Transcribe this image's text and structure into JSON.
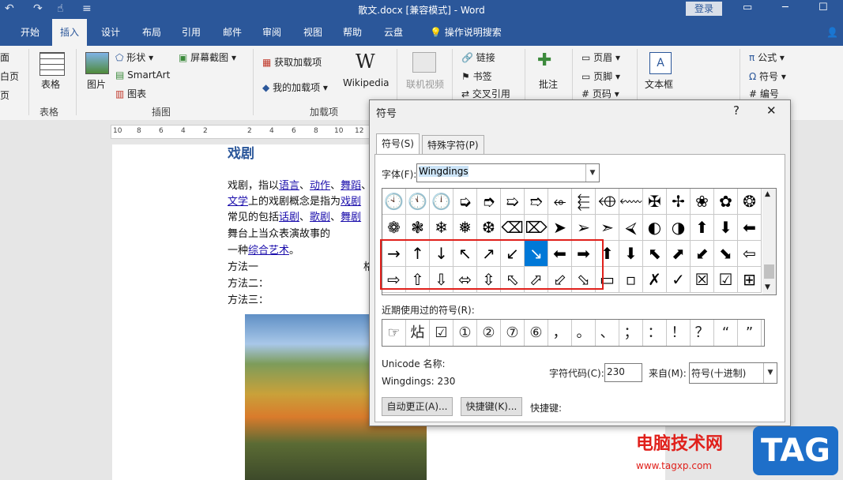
{
  "titlebar": {
    "title": "散文.docx [兼容模式] - Word",
    "login_label": "登录",
    "undo_icon": "↶",
    "redo_icon": "↷",
    "touch_icon": "☝",
    "customize_icon": "≡",
    "restore_icon": "▭",
    "minimize_icon": "─",
    "maximize_icon": "☐"
  },
  "tabs": [
    "开始",
    "插入",
    "设计",
    "布局",
    "引用",
    "邮件",
    "审阅",
    "视图",
    "帮助",
    "云盘",
    "操作说明搜索"
  ],
  "active_tab": "插入",
  "share_label": "共",
  "ribbon": {
    "left_cut": [
      "面",
      "白页",
      "页"
    ],
    "table_label": "表格",
    "table_group": "表格",
    "picture_label": "图片",
    "shapes_label": "形状",
    "smartart_label": "SmartArt",
    "chart_label": "图表",
    "screenshot_label": "屏幕截图",
    "illus_group": "插图",
    "get_addins_label": "获取加载项",
    "my_addins_label": "我的加载项",
    "wikipedia_label": "Wikipedia",
    "addins_group": "加载项",
    "online_video_label": "联机视频",
    "link_label": "链接",
    "bookmark_label": "书签",
    "crossref_label": "交叉引用",
    "comment_label": "批注",
    "header_label": "页眉",
    "footer_label": "页脚",
    "pagenum_label": "页码",
    "textbox_label": "文本框",
    "equation_label": "公式",
    "symbol_label": "符号",
    "number_label": "编号"
  },
  "ruler": [
    "10",
    "8",
    "6",
    "4",
    "2",
    "2",
    "4",
    "6",
    "8",
    "10",
    "12"
  ],
  "document": {
    "heading": "戏剧",
    "lines": [
      {
        "text": "戏剧，指以",
        "links": [
          "语言",
          "动作",
          "舞蹈"
        ]
      },
      {
        "prefix_link": "文学",
        "text": "上的戏剧概念是指为",
        "link": "戏剧"
      },
      {
        "text": "常见的包括",
        "links": [
          "话剧",
          "歌剧",
          "舞剧"
        ]
      },
      {
        "text": "舞台上当众表演故事的"
      },
      {
        "text": "一种",
        "link": "综合艺术",
        "suffix": "。"
      },
      {
        "text": "方法一",
        "extra": "格"
      },
      {
        "text": "方法二："
      },
      {
        "text": "方法三："
      }
    ]
  },
  "dialog": {
    "title": "符号",
    "help_icon": "?",
    "close_icon": "✕",
    "tab_symbols": "符号(S)",
    "tab_special": "特殊字符(P)",
    "font_label": "字体(F):",
    "font_value": "Wingdings",
    "grid_rows": [
      [
        "🕙",
        "🕚",
        "🕛",
        "➭",
        "➮",
        "➯",
        "➱",
        "⬰",
        "⬱",
        "⬲",
        "⬳",
        "✠",
        "✢",
        "❀",
        "✿",
        "❂"
      ],
      [
        "❁",
        "❃",
        "❄",
        "❅",
        "❆",
        "⌫",
        "⌦",
        "➤",
        "➢",
        "➣",
        "⮘",
        "◐",
        "◑",
        "⬆",
        "⬇",
        "⬅"
      ],
      [
        "→",
        "↑",
        "↓",
        "↖",
        "↗",
        "↙",
        "↘",
        "⬅",
        "➡",
        "⬆",
        "⬇",
        "⬉",
        "⬈",
        "⬋",
        "⬊",
        "⇦"
      ],
      [
        "⇨",
        "⇧",
        "⇩",
        "⬄",
        "⇳",
        "⬁",
        "⬀",
        "⬃",
        "⬂",
        "▭",
        "▫",
        "✗",
        "✓",
        "☒",
        "☑",
        "⊞"
      ]
    ],
    "selected_index": [
      2,
      6
    ],
    "recent_label": "近期使用过的符号(R):",
    "recent": [
      "☞",
      "炶",
      "☑",
      "①",
      "②",
      "⑦",
      "⑥",
      "，",
      "。",
      "、",
      "；",
      "：",
      "！",
      "？",
      "“",
      "”"
    ],
    "unicode_name_label": "Unicode 名称:",
    "unicode_name_value": "Wingdings: 230",
    "char_code_label": "字符代码(C):",
    "char_code_value": "230",
    "from_label": "来自(M):",
    "from_value": "符号(十进制)",
    "autocorrect_label": "自动更正(A)...",
    "shortcut_btn_label": "快捷键(K)...",
    "shortcut_label": "快捷键:"
  },
  "watermark": {
    "site_name": "电脑技术网",
    "site_url": "www.tagxp.com",
    "tag": "TAG"
  },
  "colors": {
    "accent": "#2b579a",
    "selection": "#0078d7",
    "highlight_box": "#e0201b"
  }
}
